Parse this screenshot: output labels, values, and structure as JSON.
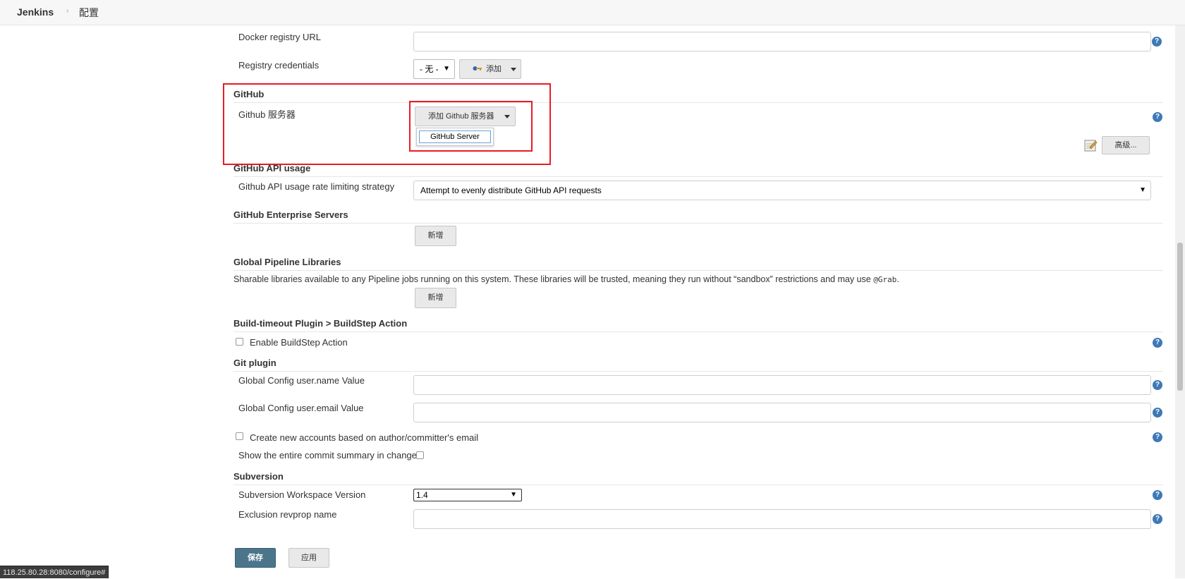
{
  "breadcrumb": {
    "brand": "Jenkins",
    "separator": "›",
    "current": "配置"
  },
  "docker": {
    "registry_url_label": "Docker registry URL",
    "registry_url_value": "",
    "credentials_label": "Registry credentials",
    "credentials_value": "- 无 -",
    "add_label": "添加"
  },
  "github": {
    "title": "GitHub",
    "servers_label": "Github 服务器",
    "add_server_label": "添加 Github 服务器",
    "menu_item": "GitHub Server",
    "advanced_label": "高级..."
  },
  "github_api": {
    "title": "GitHub API usage",
    "strategy_label": "Github API usage rate limiting strategy",
    "strategy_value": "Attempt to evenly distribute GitHub API requests"
  },
  "github_enterprise": {
    "title": "GitHub Enterprise Servers",
    "add_label": "新增"
  },
  "pipeline_libs": {
    "title": "Global Pipeline Libraries",
    "description_start": "Sharable libraries available to any Pipeline jobs running on this system. These libraries will be trusted, meaning they run without “sandbox” restrictions and may use ",
    "description_code": "@Grab",
    "description_end": ".",
    "add_label": "新增"
  },
  "build_timeout": {
    "title": "Build-timeout Plugin > BuildStep Action",
    "enable_label": "Enable BuildStep Action",
    "enable_checked": false
  },
  "git_plugin": {
    "title": "Git plugin",
    "user_name_label": "Global Config user.name Value",
    "user_name_value": "",
    "user_email_label": "Global Config user.email Value",
    "user_email_value": "",
    "create_accounts_label": "Create new accounts based on author/committer's email",
    "show_summary_label": "Show the entire commit summary in changes"
  },
  "subversion": {
    "title": "Subversion",
    "workspace_label": "Subversion Workspace Version",
    "workspace_value": "1.4",
    "exclusion_label": "Exclusion revprop name",
    "exclusion_value": ""
  },
  "actions": {
    "save": "保存",
    "apply": "应用"
  },
  "status_bar": "118.25.80.28:8080/configure#",
  "colors": {
    "highlight": "#e81c23",
    "save_button": "#4b758b",
    "help_icon": "#3e79b6"
  },
  "help_icon_glyph": "?"
}
